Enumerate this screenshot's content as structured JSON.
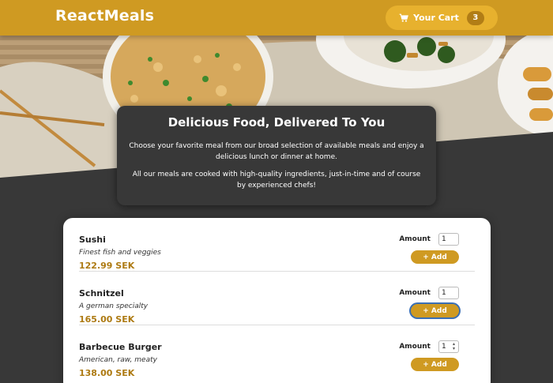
{
  "header": {
    "brand": "ReactMeals",
    "cart_label": "Your Cart",
    "cart_count": "3"
  },
  "summary": {
    "title": "Delicious Food, Delivered To You",
    "paragraph1": "Choose your favorite meal from our broad selection of available meals and enjoy a delicious lunch or dinner at home.",
    "paragraph2": "All our meals are cooked with high-quality ingredients, just-in-time and of course by experienced chefs!"
  },
  "meals": [
    {
      "name": "Sushi",
      "description": "Finest fish and veggies",
      "price": "122.99 SEK",
      "amount_label": "Amount",
      "amount": "1",
      "add_label": "+ Add"
    },
    {
      "name": "Schnitzel",
      "description": "A german specialty",
      "price": "165.00 SEK",
      "amount_label": "Amount",
      "amount": "1",
      "add_label": "+ Add"
    },
    {
      "name": "Barbecue Burger",
      "description": "American, raw, meaty",
      "price": "138.00 SEK",
      "amount_label": "Amount",
      "amount": "1",
      "add_label": "+ Add"
    }
  ],
  "colors": {
    "header": "#cf9a22",
    "cart_button": "#e7b12e",
    "background": "#383838",
    "price": "#ad7a12"
  },
  "icons": {
    "cart": "shopping-cart-icon",
    "hero": "food-photo"
  }
}
